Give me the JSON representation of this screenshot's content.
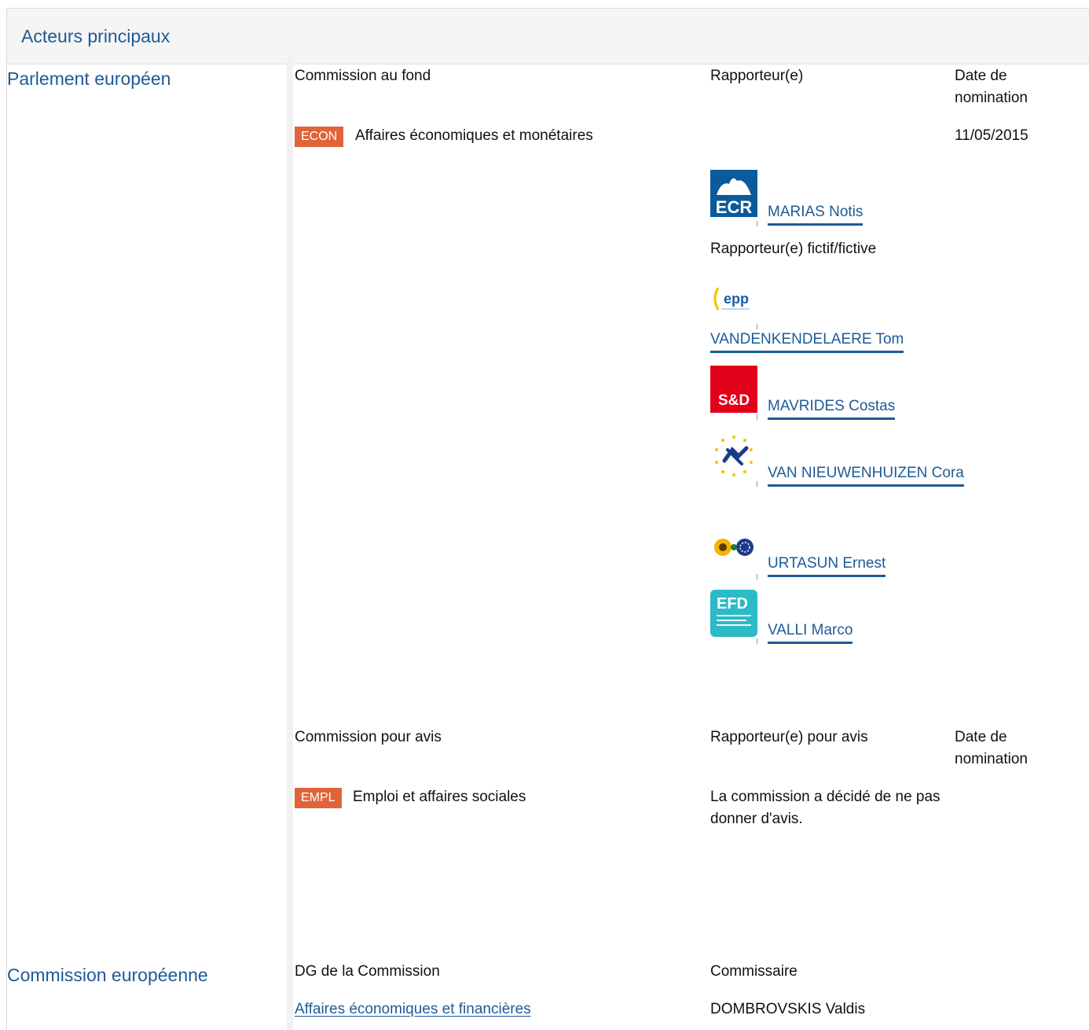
{
  "header": {
    "title": "Acteurs principaux"
  },
  "ep": {
    "label": "Parlement européen",
    "lead": {
      "col_committee": "Commission au fond",
      "col_rapporteur": "Rapporteur(e)",
      "col_date": "Date de nomination",
      "committee_code": "ECON",
      "committee_name": "Affaires économiques et monétaires",
      "date": "11/05/2015",
      "rapporteur": {
        "group_logo": "ecr-logo",
        "logo_text": "ECR",
        "name": "MARIAS Notis"
      },
      "shadow_label": "Rapporteur(e) fictif/fictive",
      "shadows": [
        {
          "group_logo": "epp-logo",
          "logo_text": "epp",
          "name": "VANDENKENDELAERE Tom"
        },
        {
          "group_logo": "sd-logo",
          "logo_text": "S&D",
          "name": "MAVRIDES Costas"
        },
        {
          "group_logo": "alde-logo",
          "name": "VAN NIEUWENHUIZEN Cora"
        },
        {
          "group_logo": "greens-efa-logo",
          "name": "URTASUN Ernest"
        },
        {
          "group_logo": "efd-logo",
          "logo_text": "EFD",
          "name": "VALLI Marco"
        }
      ]
    },
    "opinion": {
      "col_committee": "Commission pour avis",
      "col_rapporteur": "Rapporteur(e) pour avis",
      "col_date": "Date de nomination",
      "committee_code": "EMPL",
      "committee_name": "Emploi et affaires sociales",
      "note": "La commission a décidé de ne pas donner d'avis."
    }
  },
  "ec": {
    "label": "Commission européenne",
    "col_dg": "DG de la Commission",
    "col_commissioner": "Commissaire",
    "dg_link": "Affaires économiques et financières",
    "commissioner": "DOMBROVSKIS Valdis"
  },
  "colors": {
    "link": "#1f5a96",
    "badge": "#e0643a",
    "header_bg": "#f5f5f5"
  }
}
